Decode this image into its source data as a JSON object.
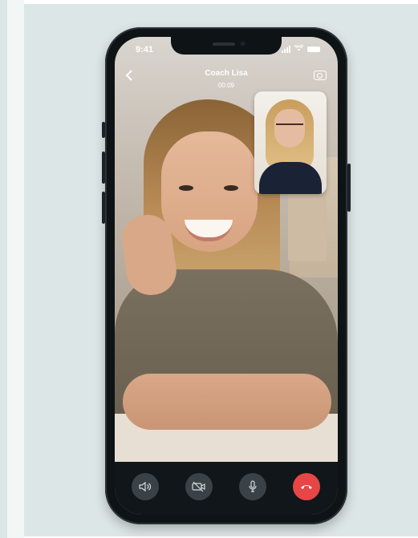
{
  "status_bar": {
    "time": "9:41"
  },
  "call": {
    "caller_name": "Coach Lisa",
    "duration": "00:09"
  },
  "controls": [
    {
      "name": "speaker",
      "icon": "speaker-icon"
    },
    {
      "name": "camera-off",
      "icon": "video-off-icon"
    },
    {
      "name": "mute",
      "icon": "mic-icon"
    },
    {
      "name": "end-call",
      "icon": "hang-up-icon"
    }
  ],
  "colors": {
    "end_call": "#e64646",
    "control_bg": "#3a4247",
    "panel_bg": "#dde6e6"
  }
}
